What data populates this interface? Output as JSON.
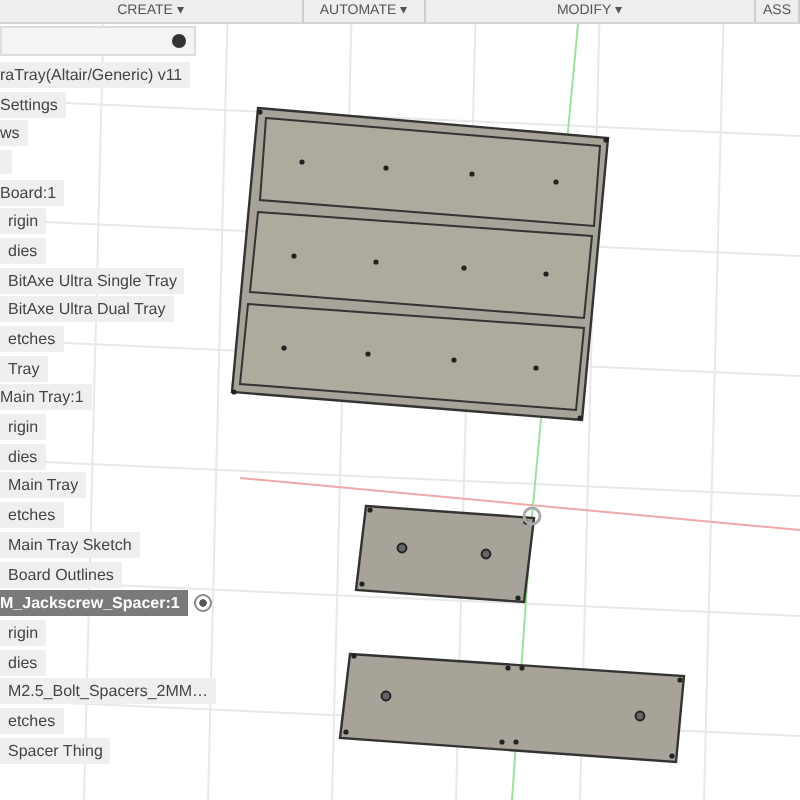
{
  "toolbar": [
    {
      "label": "CREATE ▾"
    },
    {
      "label": "AUTOMATE ▾"
    },
    {
      "label": "MODIFY ▾"
    },
    {
      "label": "ASS"
    }
  ],
  "browser": {
    "items": [
      {
        "label": "raTray(Altair/Generic) v11",
        "selected": false,
        "children": [
          {
            "label": "Settings",
            "selected": false
          },
          {
            "label": "ws",
            "selected": false
          },
          {
            "kind": "stub"
          },
          {
            "label": "Board:1",
            "selected": false,
            "children": [
              {
                "label": "rigin",
                "selected": false
              },
              {
                "label": "dies",
                "selected": false,
                "children": [
                  {
                    "label": "BitAxe Ultra Single Tray",
                    "selected": false
                  },
                  {
                    "label": "BitAxe Ultra Dual Tray",
                    "selected": false
                  }
                ]
              },
              {
                "label": "etches",
                "selected": false,
                "children": [
                  {
                    "label": "Tray",
                    "selected": false
                  }
                ]
              }
            ]
          },
          {
            "label": "Main Tray:1",
            "selected": false,
            "children": [
              {
                "label": "rigin",
                "selected": false
              },
              {
                "label": "dies",
                "selected": false,
                "children": [
                  {
                    "label": "Main Tray",
                    "selected": false
                  }
                ]
              },
              {
                "label": "etches",
                "selected": false,
                "children": [
                  {
                    "label": "Main Tray Sketch",
                    "selected": false
                  },
                  {
                    "label": "Board Outlines",
                    "selected": false
                  }
                ]
              }
            ]
          },
          {
            "label": "M_Jackscrew_Spacer:1",
            "selected": true,
            "children": [
              {
                "label": "rigin",
                "selected": false
              },
              {
                "label": "dies",
                "selected": false,
                "children": [
                  {
                    "label": "M2.5_Bolt_Spacers_2MM…",
                    "selected": false
                  }
                ]
              },
              {
                "label": "etches",
                "selected": false,
                "children": [
                  {
                    "label": "Spacer Thing",
                    "selected": false
                  }
                ]
              }
            ]
          }
        ]
      }
    ]
  }
}
